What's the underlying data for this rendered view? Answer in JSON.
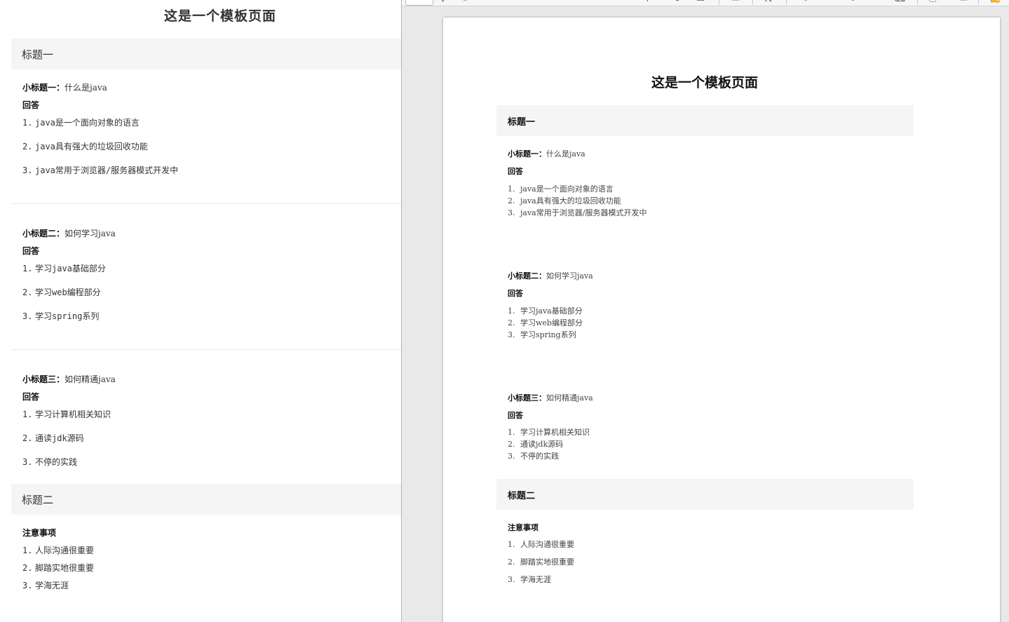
{
  "doc": {
    "title": "这是一个模板页面",
    "section1": {
      "heading": "标题一",
      "questions": [
        {
          "label": "小标题一：",
          "text": "什么是java",
          "answer_label": "回答",
          "items": [
            "java是一个面向对象的语言",
            "java具有强大的垃圾回收功能",
            "java常用于浏览器/服务器模式开发中"
          ]
        },
        {
          "label": "小标题二：",
          "text": "如何学习java",
          "answer_label": "回答",
          "items": [
            "学习java基础部分",
            "学习web编程部分",
            "学习spring系列"
          ]
        },
        {
          "label": "小标题三：",
          "text": "如何精通java",
          "answer_label": "回答",
          "items": [
            "学习计算机相关知识",
            "通读jdk源码",
            "不停的实践"
          ]
        }
      ]
    },
    "section2": {
      "heading": "标题二",
      "notes_label": "注意事项",
      "items": [
        "人际沟通很重要",
        "脚踏实地很重要",
        "学海无涯"
      ]
    },
    "numbers": [
      "1.",
      "2.",
      "3."
    ]
  },
  "viewer": {
    "icons": [
      "add-page-icon",
      "text-cursor-icon",
      "search-icon",
      "arrow-icon",
      "rotate-icon",
      "crop-icon",
      "text-icon",
      "pen-icon",
      "highlight-icon",
      "eraser-icon",
      "print-icon",
      "save-icon",
      "sign-icon"
    ]
  }
}
